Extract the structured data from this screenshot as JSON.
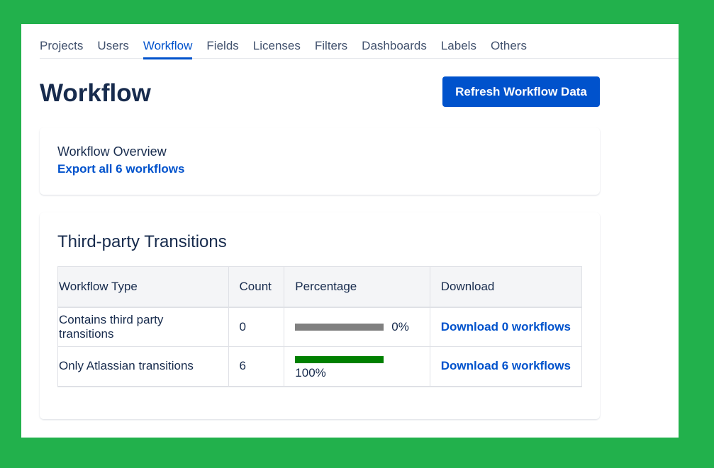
{
  "nav": {
    "tabs": [
      "Projects",
      "Users",
      "Workflow",
      "Fields",
      "Licenses",
      "Filters",
      "Dashboards",
      "Labels",
      "Others"
    ],
    "active": "Workflow"
  },
  "page": {
    "title": "Workflow",
    "refresh_label": "Refresh Workflow Data"
  },
  "overview": {
    "title": "Workflow Overview",
    "export_link": "Export all 6 workflows"
  },
  "transitions": {
    "title": "Third-party Transitions",
    "headers": [
      "Workflow Type",
      "Count",
      "Percentage",
      "Download"
    ],
    "rows": [
      {
        "type": "Contains third party transitions",
        "count": "0",
        "percent": 0,
        "percent_label": "0%",
        "download": "Download 0 workflows"
      },
      {
        "type": "Only Atlassian transitions",
        "count": "6",
        "percent": 100,
        "percent_label": "100%",
        "download": "Download 6 workflows"
      }
    ]
  },
  "colors": {
    "accent": "#0052cc",
    "bar_track": "#808080",
    "bar_fill": "#008000",
    "frame": "#22b14c"
  }
}
